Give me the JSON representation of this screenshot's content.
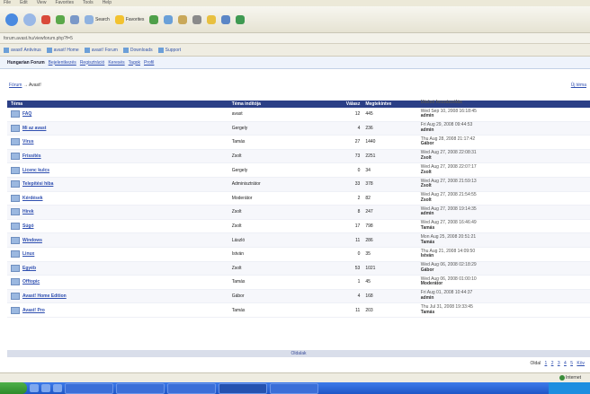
{
  "menubar": {
    "items": [
      "File",
      "Edit",
      "View",
      "Favorites",
      "Tools",
      "Help"
    ]
  },
  "toolbar": {
    "search_label": "Search",
    "favorites_label": "Favorites"
  },
  "address": {
    "text": "forum.avast.hu/viewforum.php?f=5"
  },
  "links": {
    "items": [
      "avast! Antivirus",
      "avast! Home",
      "avast! Forum",
      "Downloads",
      "Support"
    ]
  },
  "navbar": {
    "brand": "Hungarian Forum",
    "items": [
      "Bejelentkezés",
      "Regisztráció",
      "Keresés",
      "Tagok",
      "Profil"
    ]
  },
  "breadcrumb": {
    "home": "Fórum",
    "current": "Avast!"
  },
  "right_link": "Új téma",
  "table": {
    "headers": [
      "Téma",
      "Téma indítója",
      "Válasz",
      "Megtekintve",
      "Utolsó hozzászólás"
    ],
    "rows": [
      {
        "title": "FAQ",
        "author": "avast",
        "replies": "12",
        "views": "445",
        "last_date": "Wed Sep 10, 2008 16:18:45",
        "last_user": "admin"
      },
      {
        "title": "Mi az avast",
        "author": "Gergely",
        "replies": "4",
        "views": "236",
        "last_date": "Fri Aug 29, 2008 09:44:53",
        "last_user": "admin"
      },
      {
        "title": "Vírus",
        "author": "Tamás",
        "replies": "27",
        "views": "1440",
        "last_date": "Thu Aug 28, 2008 21:17:42",
        "last_user": "Gábor"
      },
      {
        "title": "Frissítés",
        "author": "Zsolt",
        "replies": "73",
        "views": "2251",
        "last_date": "Wed Aug 27, 2008 22:08:31",
        "last_user": "Zsolt"
      },
      {
        "title": "Licenc kulcs",
        "author": "Gergely",
        "replies": "0",
        "views": "34",
        "last_date": "Wed Aug 27, 2008 22:07:17",
        "last_user": "Zsolt"
      },
      {
        "title": "Telepítési hiba",
        "author": "Adminisztrátor",
        "replies": "33",
        "views": "378",
        "last_date": "Wed Aug 27, 2008 21:59:13",
        "last_user": "Zsolt"
      },
      {
        "title": "Kérdések",
        "author": "Moderátor",
        "replies": "2",
        "views": "82",
        "last_date": "Wed Aug 27, 2008 21:54:55",
        "last_user": "Zsolt"
      },
      {
        "title": "Hírek",
        "author": "Zsolt",
        "replies": "8",
        "views": "247",
        "last_date": "Wed Aug 27, 2008 19:14:35",
        "last_user": "admin"
      },
      {
        "title": "Súgó",
        "author": "Zsolt",
        "replies": "17",
        "views": "798",
        "last_date": "Wed Aug 27, 2008 16:46:49",
        "last_user": "Tamás"
      },
      {
        "title": "Windows",
        "author": "László",
        "replies": "11",
        "views": "286",
        "last_date": "Mon Aug 25, 2008 20:51:21",
        "last_user": "Tamás"
      },
      {
        "title": "Linux",
        "author": "István",
        "replies": "0",
        "views": "35",
        "last_date": "Thu Aug 21, 2008 14:09:50",
        "last_user": "István"
      },
      {
        "title": "Egyéb",
        "author": "Zsolt",
        "replies": "53",
        "views": "1021",
        "last_date": "Wed Aug 06, 2008 02:18:29",
        "last_user": "Gábor"
      },
      {
        "title": "Offtopic",
        "author": "Tamás",
        "replies": "1",
        "views": "45",
        "last_date": "Wed Aug 06, 2008 01:00:10",
        "last_user": "Moderátor"
      },
      {
        "title": "Avast! Home Edition",
        "author": "Gábor",
        "replies": "4",
        "views": "168",
        "last_date": "Fri Aug 01, 2008 10:44:37",
        "last_user": "admin"
      },
      {
        "title": "Avast! Pro",
        "author": "Tamás",
        "replies": "11",
        "views": "203",
        "last_date": "Thu Jul 31, 2008 19:33:45",
        "last_user": "Tamás"
      }
    ]
  },
  "pager_bar": "Oldalak",
  "pager": {
    "label": "Oldal",
    "pages": [
      "1",
      "2",
      "3",
      "4",
      "5"
    ],
    "next": "Köv"
  },
  "status": {
    "text": "Internet"
  },
  "colors": {
    "header_bg": "#2b3f86",
    "link": "#2f4fb0",
    "taskbar": "#1f56c7"
  }
}
